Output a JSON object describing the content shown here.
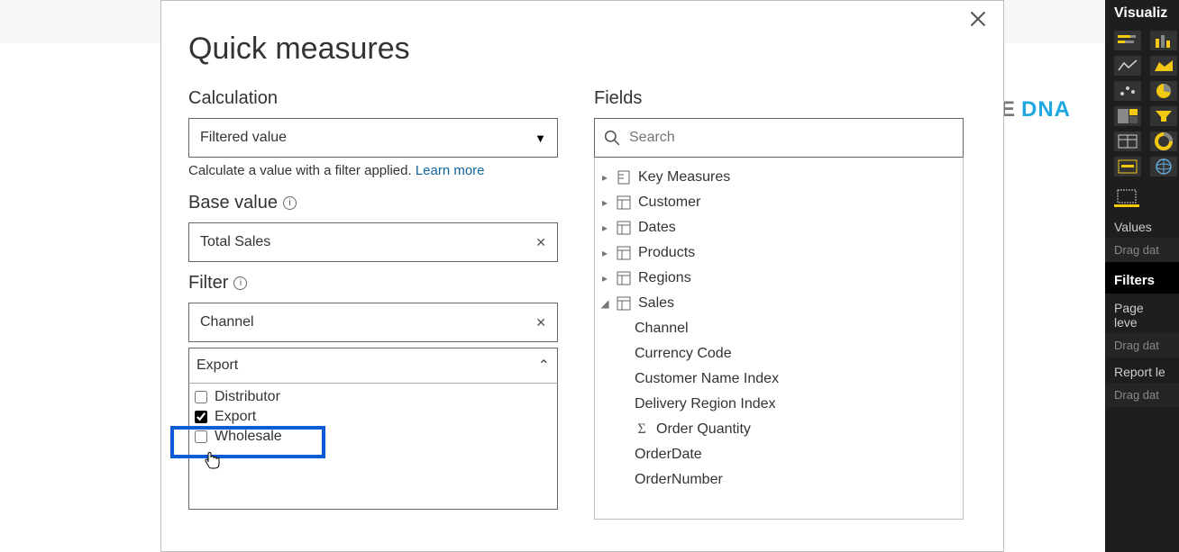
{
  "dialog": {
    "title": "Quick measures",
    "calculation": {
      "label": "Calculation",
      "value": "Filtered value",
      "helper_pre": "Calculate a value with a filter applied.  ",
      "learn_more": "Learn more"
    },
    "base_value": {
      "label": "Base value",
      "value": "Total Sales"
    },
    "filter": {
      "label": "Filter",
      "field": "Channel",
      "expanded_label": "Export",
      "options": [
        {
          "label": "Distributor",
          "checked": false
        },
        {
          "label": "Export",
          "checked": true
        },
        {
          "label": "Wholesale",
          "checked": false
        }
      ]
    }
  },
  "fields": {
    "label": "Fields",
    "search_placeholder": "Search",
    "tree": [
      {
        "name": "Key Measures",
        "icon": "measure",
        "expanded": false
      },
      {
        "name": "Customer",
        "icon": "table",
        "expanded": false
      },
      {
        "name": "Dates",
        "icon": "table",
        "expanded": false
      },
      {
        "name": "Products",
        "icon": "table",
        "expanded": false
      },
      {
        "name": "Regions",
        "icon": "table",
        "expanded": false
      },
      {
        "name": "Sales",
        "icon": "table",
        "expanded": true,
        "children": [
          {
            "name": "Channel"
          },
          {
            "name": "Currency Code"
          },
          {
            "name": "Customer Name Index"
          },
          {
            "name": "Delivery Region Index"
          },
          {
            "name": "Order Quantity",
            "sigma": true
          },
          {
            "name": "OrderDate"
          },
          {
            "name": "OrderNumber"
          }
        ]
      }
    ]
  },
  "brand": {
    "partial_e": "E",
    "dna": "DNA"
  },
  "viz_pane": {
    "title": "Visualiz",
    "values_label": "Values",
    "drag_hint": "Drag dat",
    "filters_label": "Filters",
    "page_level": "Page leve",
    "report_level": "Report le"
  }
}
